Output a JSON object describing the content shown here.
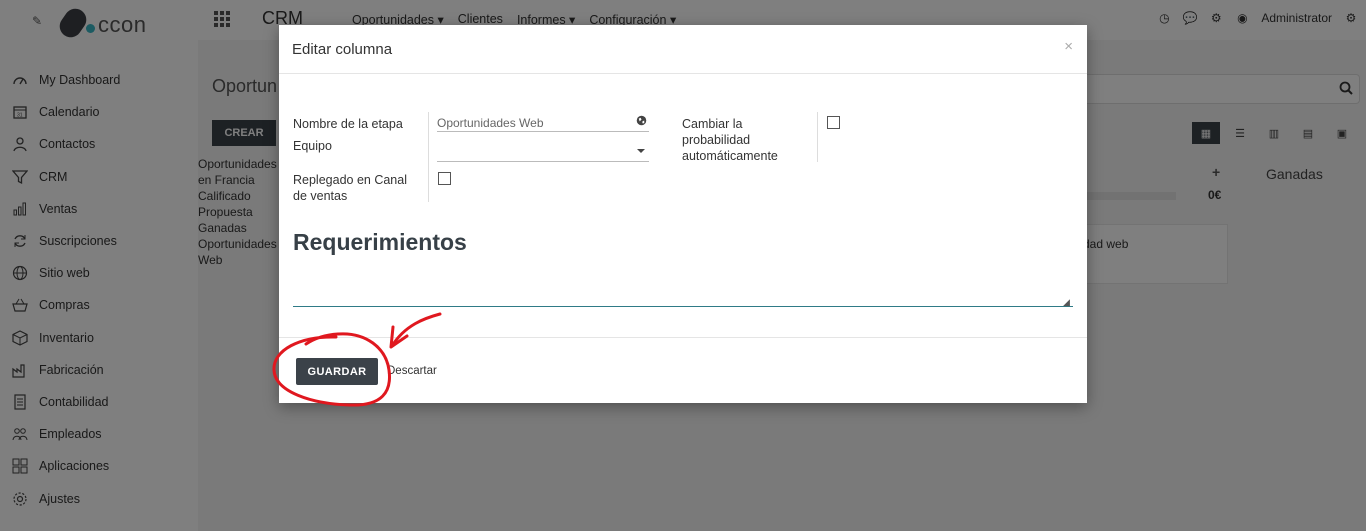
{
  "app": {
    "logo_text": "ccon",
    "module_title": "CRM",
    "nav": [
      "Oportunidades",
      "Clientes",
      "Informes",
      "Configuración"
    ],
    "nav_has_caret": [
      true,
      false,
      true,
      true
    ],
    "user": "Administrator"
  },
  "sidebar": {
    "items": [
      {
        "label": "My Dashboard",
        "icon": "dashboard-icon"
      },
      {
        "label": "Calendario",
        "icon": "calendar-icon"
      },
      {
        "label": "Contactos",
        "icon": "person-icon"
      },
      {
        "label": "CRM",
        "icon": "funnel-icon"
      },
      {
        "label": "Ventas",
        "icon": "bar-chart-icon"
      },
      {
        "label": "Suscripciones",
        "icon": "refresh-icon"
      },
      {
        "label": "Sitio web",
        "icon": "globe-icon"
      },
      {
        "label": "Compras",
        "icon": "basket-icon"
      },
      {
        "label": "Inventario",
        "icon": "box-icon"
      },
      {
        "label": "Fabricación",
        "icon": "factory-icon"
      },
      {
        "label": "Contabilidad",
        "icon": "ledger-icon"
      },
      {
        "label": "Empleados",
        "icon": "people-icon"
      },
      {
        "label": "Aplicaciones",
        "icon": "grid-icon"
      },
      {
        "label": "Ajustes",
        "icon": "settings-icon"
      }
    ]
  },
  "background": {
    "breadcrumb": "Oportun",
    "create_label": "CREAR",
    "filters": [
      "Oportunidades",
      "en Francia",
      "Calificado",
      "Propuesta",
      "Ganadas",
      "Oportunidades",
      "Web"
    ],
    "column_plus": "+",
    "column_total": "0€",
    "column_ganadas": "Ganadas",
    "card_title": "dad web"
  },
  "modal": {
    "title": "Editar columna",
    "close_label": "×",
    "fields": {
      "stage_name_label": "Nombre de la etapa",
      "stage_name_value": "Oportunidades Web",
      "team_label": "Equipo",
      "team_value": "",
      "folded_label": "Replegado en Canal de ventas",
      "folded_checked": false,
      "change_probability_label": "Cambiar la probabilidad automáticamente",
      "change_probability_checked": false
    },
    "requirements_title": "Requerimientos",
    "requirements_value": "",
    "save_label": "GUARDAR",
    "discard_label": "Descartar"
  },
  "colors": {
    "primary_button": "#3b4249",
    "annotation": "#e0181f",
    "textarea_underline": "#2f7b87"
  }
}
